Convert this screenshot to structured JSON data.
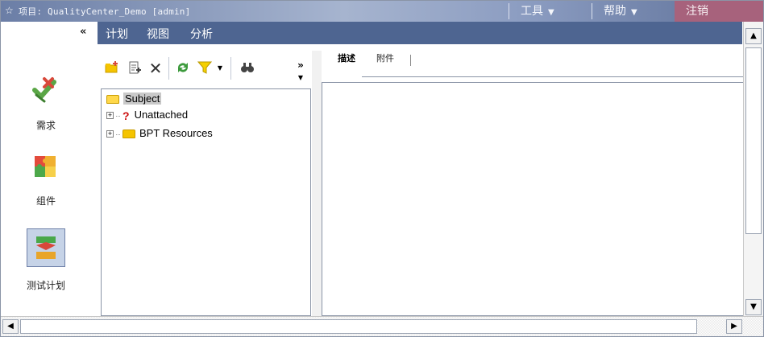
{
  "titlebar": {
    "icon": "star-icon",
    "project_text": "项目: QualityCenter_Demo [admin]",
    "tools_label": "工具",
    "help_label": "帮助",
    "logout_label": "注销",
    "logout_color": "#a7627c"
  },
  "nav": {
    "items": [
      "计划",
      "视图",
      "分析"
    ],
    "bg_color": "#4e6591"
  },
  "sidebar": {
    "collapse_glyph": "«",
    "modules": [
      {
        "label": "需求",
        "icon": "requirements-icon"
      },
      {
        "label": "组件",
        "icon": "components-icon"
      },
      {
        "label": "测试计划",
        "icon": "test-plan-icon",
        "selected": true
      }
    ]
  },
  "toolbar": {
    "buttons": [
      "new-folder-icon",
      "new-test-icon",
      "delete-icon",
      "refresh-icon",
      "filter-icon",
      "find-icon",
      "more-icon"
    ]
  },
  "tree": {
    "root": "Subject",
    "items": [
      {
        "label": "Unattached",
        "icon": "question-mark-icon"
      },
      {
        "label": "BPT Resources",
        "icon": "folder-icon"
      }
    ]
  },
  "tabs": {
    "items": [
      "描述",
      "附件"
    ],
    "active": "描述"
  }
}
